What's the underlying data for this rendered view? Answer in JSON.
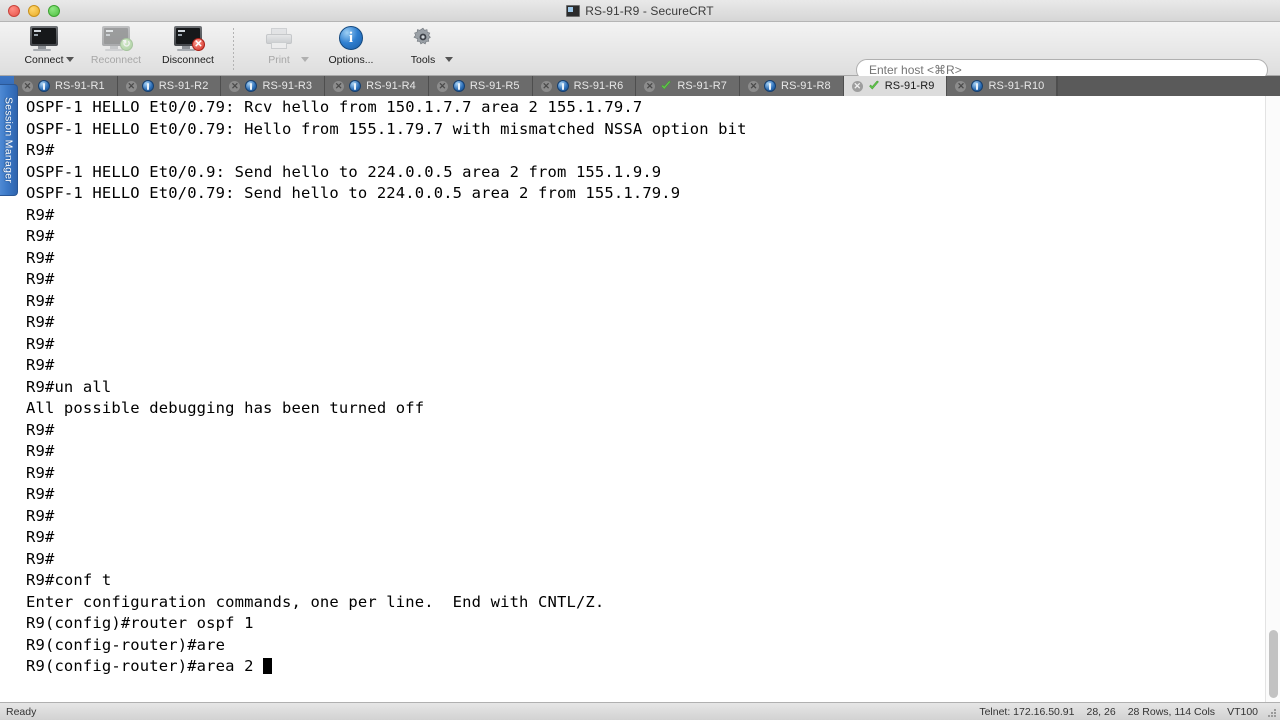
{
  "window": {
    "title": "RS-91-R9 - SecureCRT",
    "title_icon": "terminal-icon",
    "controls": {
      "close": "close",
      "minimize": "minimize",
      "zoom": "zoom"
    }
  },
  "toolbar": {
    "items": [
      {
        "label": "Connect",
        "icon": "monitor-icon",
        "disabled": false,
        "has_caret": true
      },
      {
        "label": "Reconnect",
        "icon": "monitor-reconnect-icon",
        "disabled": true,
        "has_caret": false
      },
      {
        "label": "Disconnect",
        "icon": "monitor-disconnect-icon",
        "disabled": false,
        "has_caret": false
      },
      {
        "label": "Print",
        "icon": "printer-icon",
        "disabled": true,
        "has_caret": true
      },
      {
        "label": "Options...",
        "icon": "info-icon",
        "disabled": false,
        "has_caret": false
      },
      {
        "label": "Tools",
        "icon": "gear-icon",
        "disabled": false,
        "has_caret": true
      }
    ]
  },
  "host": {
    "placeholder": "Enter host <⌘R>",
    "value": ""
  },
  "sidebar": {
    "label": "Session Manager"
  },
  "tabs": [
    {
      "label": "RS-91-R1",
      "status": "blue",
      "active": false
    },
    {
      "label": "RS-91-R2",
      "status": "blue",
      "active": false
    },
    {
      "label": "RS-91-R3",
      "status": "blue",
      "active": false
    },
    {
      "label": "RS-91-R4",
      "status": "blue",
      "active": false
    },
    {
      "label": "RS-91-R5",
      "status": "blue",
      "active": false
    },
    {
      "label": "RS-91-R6",
      "status": "blue",
      "active": false
    },
    {
      "label": "RS-91-R7",
      "status": "check",
      "active": false
    },
    {
      "label": "RS-91-R8",
      "status": "blue",
      "active": false
    },
    {
      "label": "RS-91-R9",
      "status": "check",
      "active": true
    },
    {
      "label": "RS-91-R10",
      "status": "blue",
      "active": false
    }
  ],
  "terminal": {
    "lines": [
      "OSPF-1 HELLO Et0/0.79: Rcv hello from 150.1.7.7 area 2 155.1.79.7",
      "OSPF-1 HELLO Et0/0.79: Hello from 155.1.79.7 with mismatched NSSA option bit",
      "R9#",
      "OSPF-1 HELLO Et0/0.9: Send hello to 224.0.0.5 area 2 from 155.1.9.9",
      "OSPF-1 HELLO Et0/0.79: Send hello to 224.0.0.5 area 2 from 155.1.79.9",
      "R9#",
      "R9#",
      "R9#",
      "R9#",
      "R9#",
      "R9#",
      "R9#",
      "R9#",
      "R9#un all",
      "All possible debugging has been turned off",
      "R9#",
      "R9#",
      "R9#",
      "R9#",
      "R9#",
      "R9#",
      "R9#",
      "R9#conf t",
      "Enter configuration commands, one per line.  End with CNTL/Z.",
      "R9(config)#router ospf 1",
      "R9(config-router)#are",
      "R9(config-router)#area 2 "
    ],
    "cursor_on_last_line": true,
    "background": "#ffffff",
    "foreground": "#000000"
  },
  "statusbar": {
    "left": "Ready",
    "connection": "Telnet: 172.16.50.91",
    "cursor_pos": "28, 26",
    "dimensions": "28 Rows, 114 Cols",
    "emulation": "VT100"
  }
}
